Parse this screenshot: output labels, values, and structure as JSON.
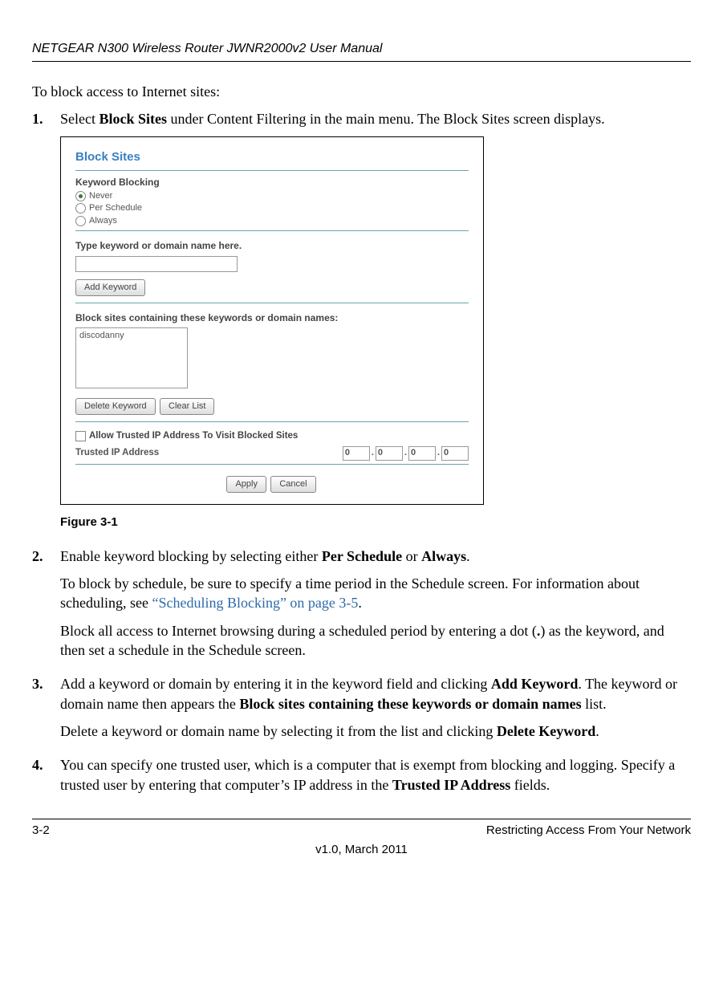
{
  "header": {
    "title": "NETGEAR N300 Wireless Router JWNR2000v2 User Manual"
  },
  "intro": "To block access to Internet sites:",
  "steps": {
    "s1": {
      "num": "1.",
      "pre": "Select ",
      "bold": "Block Sites",
      "post": " under Content Filtering in the main menu. The Block Sites screen displays."
    },
    "s2": {
      "num": "2.",
      "pre": "Enable keyword blocking by selecting either ",
      "b1": "Per Schedule",
      "mid": " or ",
      "b2": "Always",
      "post": ".",
      "para2_pre": "To block by schedule, be sure to specify a time period in the Schedule screen. For information about scheduling, see ",
      "link": "“Scheduling Blocking” on page 3-5",
      "para2_post": ".",
      "para3_pre": "Block all access to Internet browsing during a scheduled period by entering a dot (",
      "dot": ".",
      "para3_post": ") as the keyword, and then set a schedule in the Schedule screen."
    },
    "s3": {
      "num": "3.",
      "pre": "Add a keyword or domain by entering it in the keyword field and clicking ",
      "b1": "Add Keyword",
      "mid": ". The keyword or domain name then appears the ",
      "b2": "Block sites containing these keywords or domain names",
      "post": " list.",
      "para2_pre": "Delete a keyword or domain name by selecting it from the list and clicking ",
      "b3": "Delete Keyword",
      "para2_post": "."
    },
    "s4": {
      "num": "4.",
      "pre": "You can specify one trusted user, which is a computer that is exempt from blocking and logging. Specify a trusted user by entering that computer’s IP address in the ",
      "b1": "Trusted IP Address",
      "post": " fields."
    }
  },
  "figure": {
    "title": "Block Sites",
    "kw_heading": "Keyword Blocking",
    "opt_never": "Never",
    "opt_sched": "Per Schedule",
    "opt_always": "Always",
    "type_label": "Type keyword or domain name here.",
    "add_btn": "Add Keyword",
    "list_heading": "Block sites containing these keywords or domain names:",
    "list_item": "discodanny",
    "del_btn": "Delete Keyword",
    "clear_btn": "Clear List",
    "allow_label": "Allow Trusted IP Address To Visit Blocked Sites",
    "trusted_label": "Trusted IP Address",
    "ip": {
      "a": "0",
      "b": "0",
      "c": "0",
      "d": "0"
    },
    "apply_btn": "Apply",
    "cancel_btn": "Cancel",
    "caption": "Figure 3-1"
  },
  "footer": {
    "page": "3-2",
    "chapter": "Restricting Access From Your Network",
    "version": "v1.0, March 2011"
  }
}
